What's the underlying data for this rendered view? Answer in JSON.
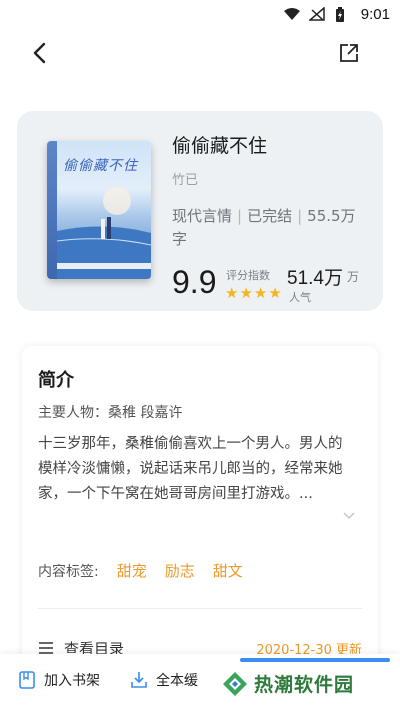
{
  "status_bar": {
    "time": "9:01"
  },
  "nav": {
    "back_icon": "chevron-left-icon",
    "share_icon": "share-icon"
  },
  "book": {
    "title": "偷偷藏不住",
    "author": "竹已",
    "genre": "现代言情",
    "status": "已完结",
    "word_count": "55.5万字",
    "score": "9.9",
    "score_label": "评分指数",
    "star_rating": 4,
    "popularity_value": "51.4万",
    "popularity_unit": "万",
    "popularity_label": "人气",
    "cover_title": "偷偷藏不住"
  },
  "intro": {
    "heading": "简介",
    "main_characters": "主要人物：桑稚 段嘉许",
    "synopsis": "十三岁那年，桑稚偷偷喜欢上一个男人。男人的模样冷淡慵懒，说起话来吊儿郎当的，经常来她家，一个下午窝在她哥哥房间里打游戏。...",
    "tags_label": "内容标签:",
    "tags": [
      "甜宠",
      "励志",
      "甜文"
    ],
    "toc_label": "查看目录",
    "toc_update": "2020-12-30 更新"
  },
  "bottom_bar": {
    "add_shelf_label": "加入书架",
    "download_label": "全本缓"
  },
  "watermark": {
    "text": "热潮软件园"
  },
  "colors": {
    "accent": "#ec9a2a",
    "star": "#f3b521",
    "card_bg": "#eef1f4",
    "primary_blue": "#3a8ef0"
  }
}
